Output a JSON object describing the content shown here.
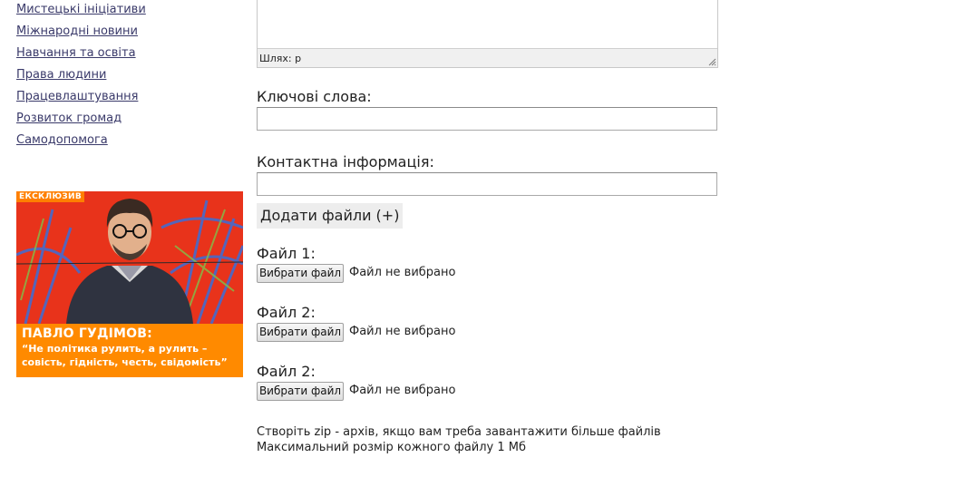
{
  "sidebar": {
    "categories": [
      "Мистецькі ініціативи",
      "Міжнародні новини",
      "Навчання та освіта",
      "Права людини",
      "Працевлаштування",
      "Розвиток громад",
      "Самодопомога"
    ]
  },
  "banner": {
    "tag": "ЕКСКЛЮЗИВ",
    "name": "ПАВЛО ГУДІМОВ:",
    "quote": "“Не політика рулить, а рулить – совість, гідність, честь, свідомість”"
  },
  "editor": {
    "path_label": "Шлях: p"
  },
  "form": {
    "keywords_label": "Ключові слова:",
    "contact_label": "Контактна інформація:",
    "add_files_label": "Додати файли (+)",
    "files": [
      {
        "label": "Файл 1:",
        "button": "Вибрати файл",
        "status": "Файл не вибрано"
      },
      {
        "label": "Файл 2:",
        "button": "Вибрати файл",
        "status": "Файл не вибрано"
      },
      {
        "label": "Файл 2:",
        "button": "Вибрати файл",
        "status": "Файл не вибрано"
      }
    ],
    "note_zip": "Створіть zip - архів, якщо вам треба завантажити більше файлів",
    "note_max": "Максимальний розмір кожного файлу 1 Мб"
  },
  "colors": {
    "link": "#3a3a6a",
    "banner_caption": "#ff8a00",
    "banner_art": "#e8331b"
  }
}
